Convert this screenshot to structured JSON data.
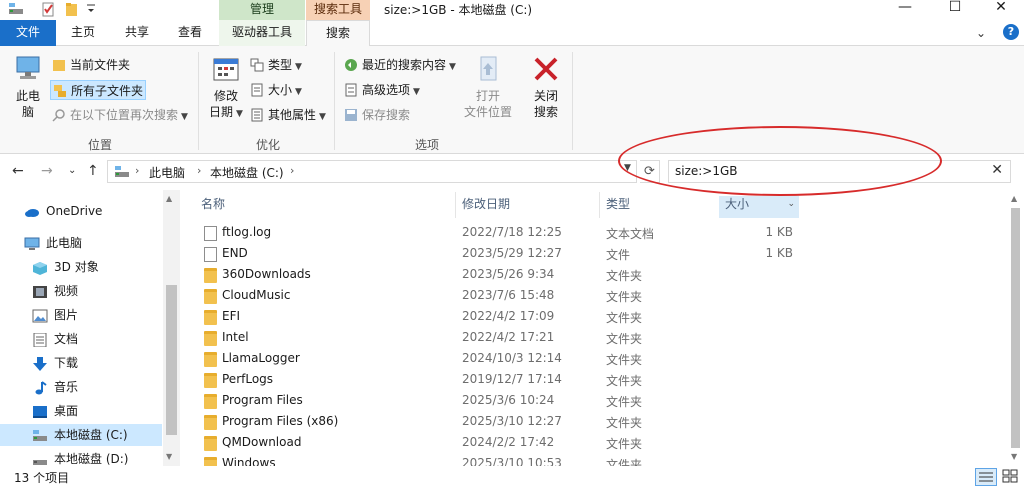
{
  "window": {
    "title": "size:>1GB - 本地磁盘 (C:)",
    "context_manage": "管理",
    "context_search": "搜索工具",
    "minimize": "—",
    "maximize": "☐",
    "close": "✕"
  },
  "tabs": {
    "file": "文件",
    "home": "主页",
    "share": "共享",
    "view": "查看",
    "drive_tools": "驱动器工具",
    "search": "搜索",
    "ribbon_toggle": "⌄",
    "help": "?"
  },
  "ribbon": {
    "location_group": "位置",
    "this_pc_line1": "此电",
    "this_pc_line2": "脑",
    "current_folder": "当前文件夹",
    "all_subfolders": "所有子文件夹",
    "search_again": "在以下位置再次搜索",
    "refine_group": "优化",
    "date_modified_line1": "修改",
    "date_modified_line2": "日期",
    "kind": "类型",
    "size": "大小",
    "other_properties": "其他属性",
    "options_group": "选项",
    "recent_searches": "最近的搜索内容",
    "advanced_options": "高级选项",
    "save_search": "保存搜索",
    "open_location_line1": "打开",
    "open_location_line2": "文件位置",
    "close_search_line1": "关闭",
    "close_search_line2": "搜索"
  },
  "address": {
    "back": "←",
    "forward": "→",
    "recent": "⌄",
    "up": "↑",
    "crumbs": [
      "此电脑",
      "本地磁盘 (C:)"
    ],
    "refresh": "⟳",
    "search_value": "size:>1GB",
    "search_clear": "✕"
  },
  "navpane": {
    "items": [
      "OneDrive",
      "此电脑",
      "3D 对象",
      "视频",
      "图片",
      "文档",
      "下载",
      "音乐",
      "桌面",
      "本地磁盘 (C:)",
      "本地磁盘 (D:)"
    ]
  },
  "columns": {
    "name": "名称",
    "date": "修改日期",
    "type": "类型",
    "size": "大小"
  },
  "files": [
    {
      "name": "ftlog.log",
      "date": "2022/7/18 12:25",
      "type": "文本文档",
      "size": "1 KB",
      "kind": "file"
    },
    {
      "name": "END",
      "date": "2023/5/29 12:27",
      "type": "文件",
      "size": "1 KB",
      "kind": "file"
    },
    {
      "name": "360Downloads",
      "date": "2023/5/26 9:34",
      "type": "文件夹",
      "size": "",
      "kind": "folder"
    },
    {
      "name": "CloudMusic",
      "date": "2023/7/6 15:48",
      "type": "文件夹",
      "size": "",
      "kind": "folder"
    },
    {
      "name": "EFI",
      "date": "2022/4/2 17:09",
      "type": "文件夹",
      "size": "",
      "kind": "folder"
    },
    {
      "name": "Intel",
      "date": "2022/4/2 17:21",
      "type": "文件夹",
      "size": "",
      "kind": "folder"
    },
    {
      "name": "LlamaLogger",
      "date": "2024/10/3 12:14",
      "type": "文件夹",
      "size": "",
      "kind": "folder"
    },
    {
      "name": "PerfLogs",
      "date": "2019/12/7 17:14",
      "type": "文件夹",
      "size": "",
      "kind": "folder"
    },
    {
      "name": "Program Files",
      "date": "2025/3/6 10:24",
      "type": "文件夹",
      "size": "",
      "kind": "folder"
    },
    {
      "name": "Program Files (x86)",
      "date": "2025/3/10 12:27",
      "type": "文件夹",
      "size": "",
      "kind": "folder"
    },
    {
      "name": "QMDownload",
      "date": "2024/2/2 17:42",
      "type": "文件夹",
      "size": "",
      "kind": "folder"
    },
    {
      "name": "Windows",
      "date": "2025/3/10 10:53",
      "type": "文件夹",
      "size": "",
      "kind": "folder"
    }
  ],
  "status": {
    "count": "13 个项目"
  },
  "colors": {
    "accent": "#1a6fc9",
    "selection": "#cce8ff",
    "annotation": "#d72b2b"
  }
}
